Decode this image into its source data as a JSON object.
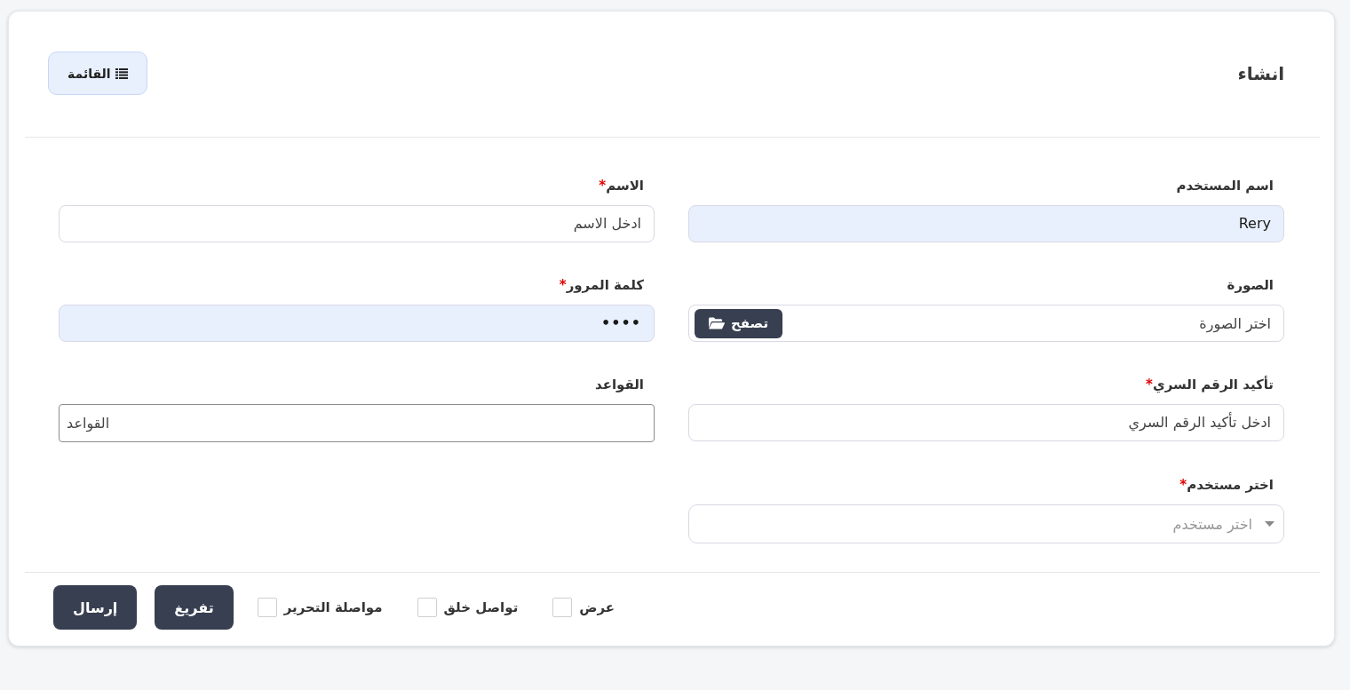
{
  "header": {
    "title": "انشاء",
    "list_button": {
      "label": "القائمة"
    }
  },
  "required_mark": "*",
  "fields": [
    {
      "kind": "text",
      "label": "اسم المستخدم",
      "required": false,
      "value": "Rery",
      "autofilled": true
    },
    {
      "kind": "text",
      "label": "الاسم",
      "required": true,
      "placeholder": "ادخل الاسم",
      "autofilled": false
    },
    {
      "kind": "file",
      "label": "الصورة",
      "required": false,
      "placeholder": "اختر الصورة",
      "browse_label": "تصفح"
    },
    {
      "kind": "password",
      "label": "كلمة المرور",
      "required": true,
      "value": "••••",
      "autofilled": true
    },
    {
      "kind": "text",
      "label": "تأكيد الرقم السري",
      "required": true,
      "placeholder": "ادخل تأكيد الرقم السري",
      "autofilled": false
    },
    {
      "kind": "plain",
      "label": "القواعد",
      "required": false,
      "placeholder": "القواعد"
    },
    {
      "kind": "select",
      "label": "اختر مستخدم",
      "required": true,
      "placeholder": "اختر مستخدم"
    }
  ],
  "options": [
    {
      "label": "عرض",
      "checked": false
    },
    {
      "label": "تواصل خلق",
      "checked": false
    },
    {
      "label": "مواصلة التحرير",
      "checked": false
    }
  ],
  "buttons": [
    {
      "label": "تفريغ"
    },
    {
      "label": "إرسال"
    }
  ]
}
